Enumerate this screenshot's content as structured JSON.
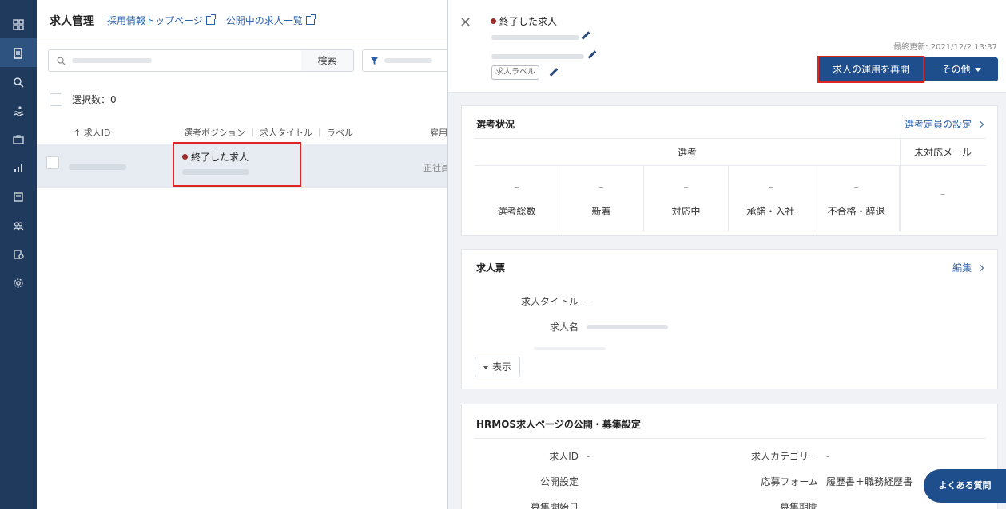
{
  "sidebar": {
    "icons": [
      "dashboard-icon",
      "jobs-icon",
      "search-candidates-icon",
      "swim-icon",
      "briefcase-icon",
      "analytics-icon",
      "documents-icon",
      "people-icon",
      "export-icon",
      "settings-icon"
    ]
  },
  "list": {
    "title": "求人管理",
    "link_top": "採用情報トップページ",
    "link_public": "公開中の求人一覧",
    "search_button": "検索",
    "selected_label": "選択数：0",
    "col_id": "↑ 求人ID",
    "col_position": "選考ポジション ｜ 求人タイトル ｜ ラベル",
    "col_employment": "雇用",
    "row": {
      "status": "終了した求人",
      "employment": "正社員"
    }
  },
  "detail": {
    "status": "終了した求人",
    "label_tag": "求人ラベル",
    "updated": "最終更新: 2021/12/2 13:37",
    "resume_button": "求人の運用を再開",
    "more_button": "その他",
    "selection": {
      "title": "選考状況",
      "link": "選考定員の設定",
      "header_selection": "選考",
      "header_mail": "未対応メール",
      "cells": [
        {
          "value": "–",
          "label": "選考総数"
        },
        {
          "value": "–",
          "label": "新着"
        },
        {
          "value": "–",
          "label": "対応中"
        },
        {
          "value": "–",
          "label": "承諾・入社"
        },
        {
          "value": "–",
          "label": "不合格・辞退"
        }
      ],
      "mail_value": "–"
    },
    "jobsheet": {
      "title": "求人票",
      "link": "編集",
      "field_title_key": "求人タイトル",
      "field_title_val": "-",
      "field_name_key": "求人名",
      "show_button": "表示"
    },
    "hrmos": {
      "title": "HRMOS求人ページの公開・募集設定",
      "job_id_key": "求人ID",
      "job_id_val": "-",
      "category_key": "求人カテゴリー",
      "category_val": "-",
      "publish_key": "公開設定",
      "form_key": "応募フォーム",
      "form_val": "履歴書＋職務経歴書",
      "start_key": "募集開始日",
      "period_key": "募集期間"
    }
  },
  "faq_button": "よくある質問"
}
